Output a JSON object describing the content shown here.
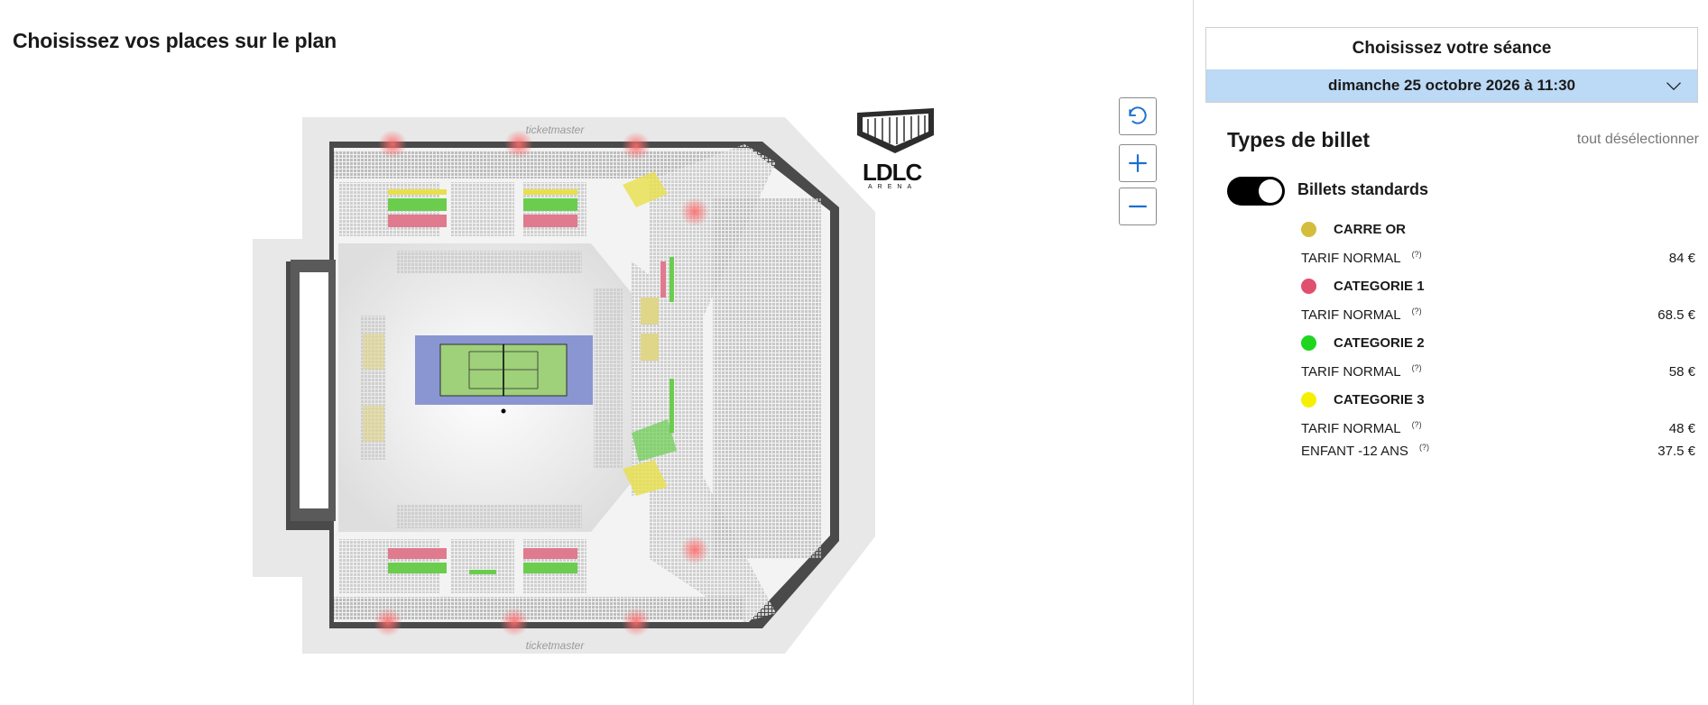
{
  "page": {
    "title": "Choisissez vos places sur le plan"
  },
  "map": {
    "watermark_top": "ticketmaster",
    "watermark_bottom": "ticketmaster",
    "logo_main": "LDLC",
    "logo_sub": "ARENA",
    "controls": [
      {
        "name": "reset-view",
        "icon": "rotate-ccw-icon"
      },
      {
        "name": "zoom-in",
        "icon": "plus-icon"
      },
      {
        "name": "zoom-out",
        "icon": "minus-icon"
      }
    ]
  },
  "session": {
    "title": "Choisissez votre séance",
    "selected": "dimanche 25 octobre 2026 à 11:30",
    "icon": "chevron-down-icon"
  },
  "tickets": {
    "title": "Types de billet",
    "deselect_all": "tout désélectionner",
    "group": {
      "label": "Billets standards",
      "enabled": true
    },
    "categories": [
      {
        "name": "CARRE OR",
        "color": "#d4bd3c",
        "rates": [
          {
            "label": "TARIF NORMAL",
            "help": "(?)",
            "price": "84 €"
          }
        ]
      },
      {
        "name": "CATEGORIE 1",
        "color": "#e0506e",
        "rates": [
          {
            "label": "TARIF NORMAL",
            "help": "(?)",
            "price": "68.5 €"
          }
        ]
      },
      {
        "name": "CATEGORIE 2",
        "color": "#1fd61f",
        "rates": [
          {
            "label": "TARIF NORMAL",
            "help": "(?)",
            "price": "58 €"
          }
        ]
      },
      {
        "name": "CATEGORIE 3",
        "color": "#f5f000",
        "rates": [
          {
            "label": "TARIF NORMAL",
            "help": "(?)",
            "price": "48 €"
          },
          {
            "label": "ENFANT -12 ANS",
            "help": "(?)",
            "price": "37.5 €"
          }
        ]
      }
    ]
  },
  "colors": {
    "accent": "#1a6fd1",
    "session_bg": "#bcd9f5",
    "court_bg": "#8a96d2",
    "court": "#9fd07a"
  }
}
